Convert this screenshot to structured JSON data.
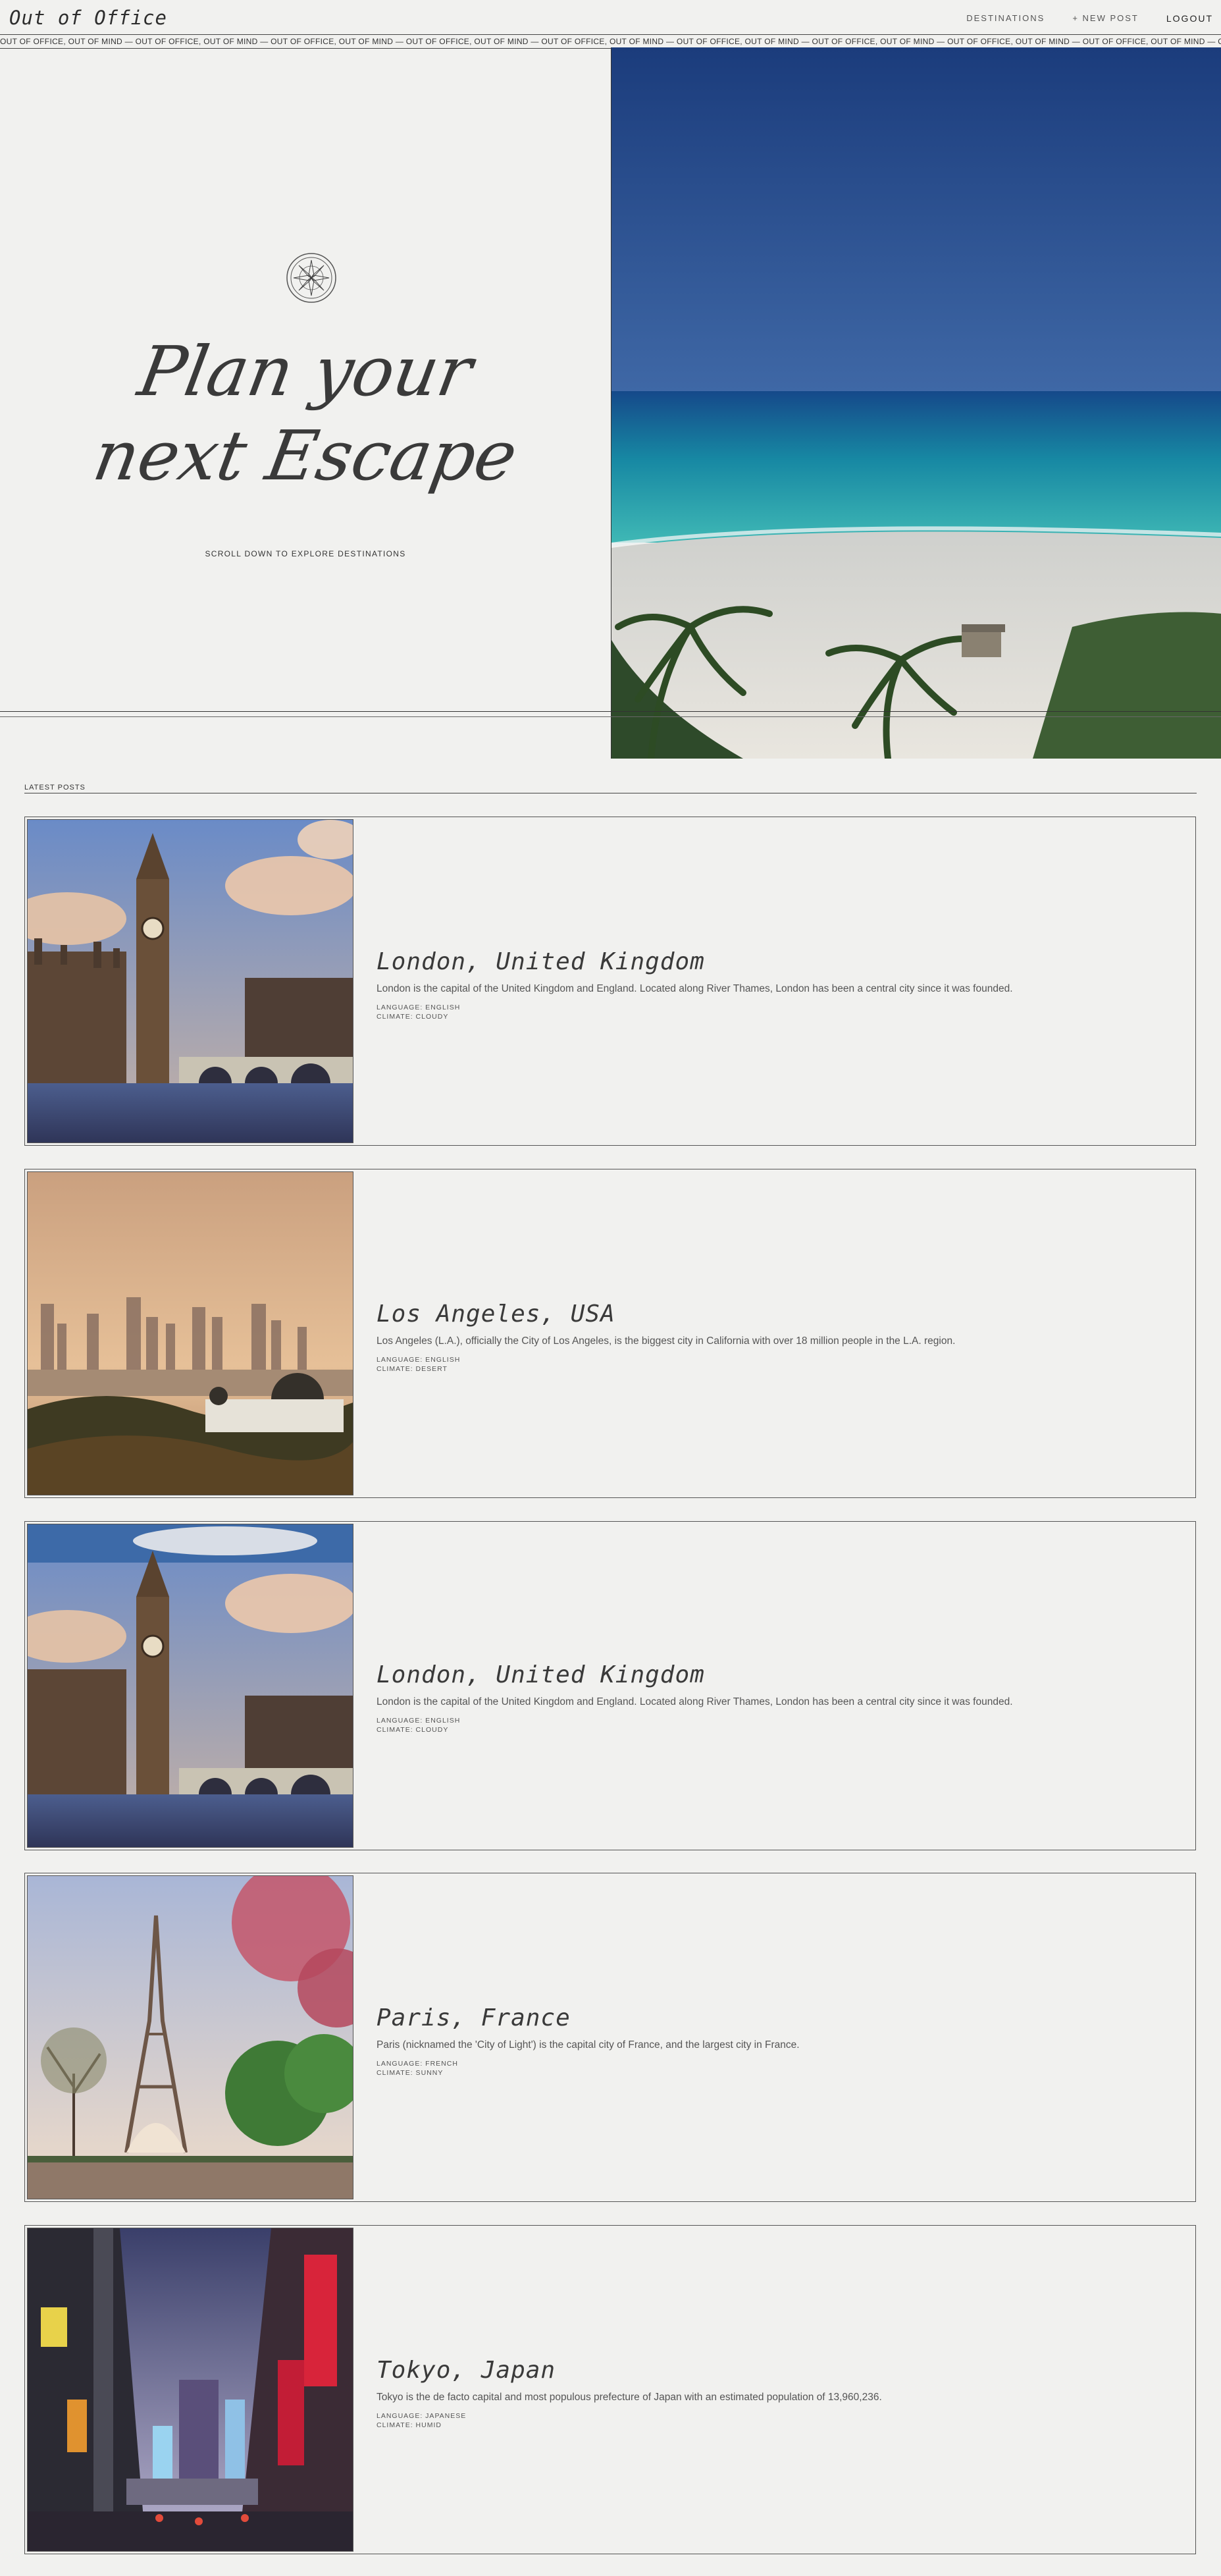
{
  "header": {
    "brand": "Out of Office",
    "nav": [
      {
        "label": "DESTINATIONS"
      },
      {
        "label": "+ NEW POST"
      },
      {
        "label": "LOGOUT"
      }
    ],
    "ticker": "OUT OF OFFICE, OUT OF MIND — OUT OF OFFICE, OUT OF MIND — OUT OF OFFICE, OUT OF MIND — OUT OF OFFICE, OUT OF MIND — OUT OF OFFICE, OUT OF MIND — OUT OF OFFICE, OUT OF MIND — OUT OF OFFICE, OUT OF MIND — OUT OF OFFICE, OUT OF MIND — OUT OF OFFICE, OUT OF MIND — OUT OF OFFICE, OUT OF MIND — OUT OF OFFICE, OUT OF MIND — OUT OF OFFICE, OUT OF MIND — OUT OF OFFICE, OUT OF MIND"
  },
  "hero": {
    "title_line1": "Plan your",
    "title_line2": "next Escape",
    "scroll_hint": "SCROLL DOWN TO EXPLORE DESTINATIONS",
    "image_icon": "beach-photo"
  },
  "posts": {
    "label": "LATEST POSTS",
    "items": [
      {
        "title": "London, United Kingdom",
        "description": "London is the capital of the United Kingdom and England. Located along River Thames, London has been a central city since it was founded.",
        "language": "LANGUAGE: ENGLISH",
        "climate": "CLIMATE: CLOUDY",
        "image_icon": "big-ben-photo"
      },
      {
        "title": "Los Angeles, USA",
        "description": "Los Angeles (L.A.), officially the City of Los Angeles, is the biggest city in California with over 18 million people in the L.A. region.",
        "language": "LANGUAGE: ENGLISH",
        "climate": "CLIMATE: DESERT",
        "image_icon": "los-angeles-skyline-photo"
      },
      {
        "title": "London, United Kingdom",
        "description": "London is the capital of the United Kingdom and England. Located along River Thames, London has been a central city since it was founded.",
        "language": "LANGUAGE: ENGLISH",
        "climate": "CLIMATE: CLOUDY",
        "image_icon": "big-ben-photo"
      },
      {
        "title": "Paris, France",
        "description": "Paris (nicknamed the 'City of Light') is the capital city of France, and the largest city in France.",
        "language": "LANGUAGE: FRENCH",
        "climate": "CLIMATE: SUNNY",
        "image_icon": "eiffel-tower-photo"
      },
      {
        "title": "Tokyo, Japan",
        "description": "Tokyo is the de facto capital and most populous prefecture of Japan with an estimated population of 13,960,236.",
        "language": "LANGUAGE: JAPANESE",
        "climate": "CLIMATE: HUMID",
        "image_icon": "tokyo-street-photo"
      }
    ]
  },
  "colors": {
    "background": "#f1f1ef",
    "text": "#333333",
    "border": "#555555"
  }
}
